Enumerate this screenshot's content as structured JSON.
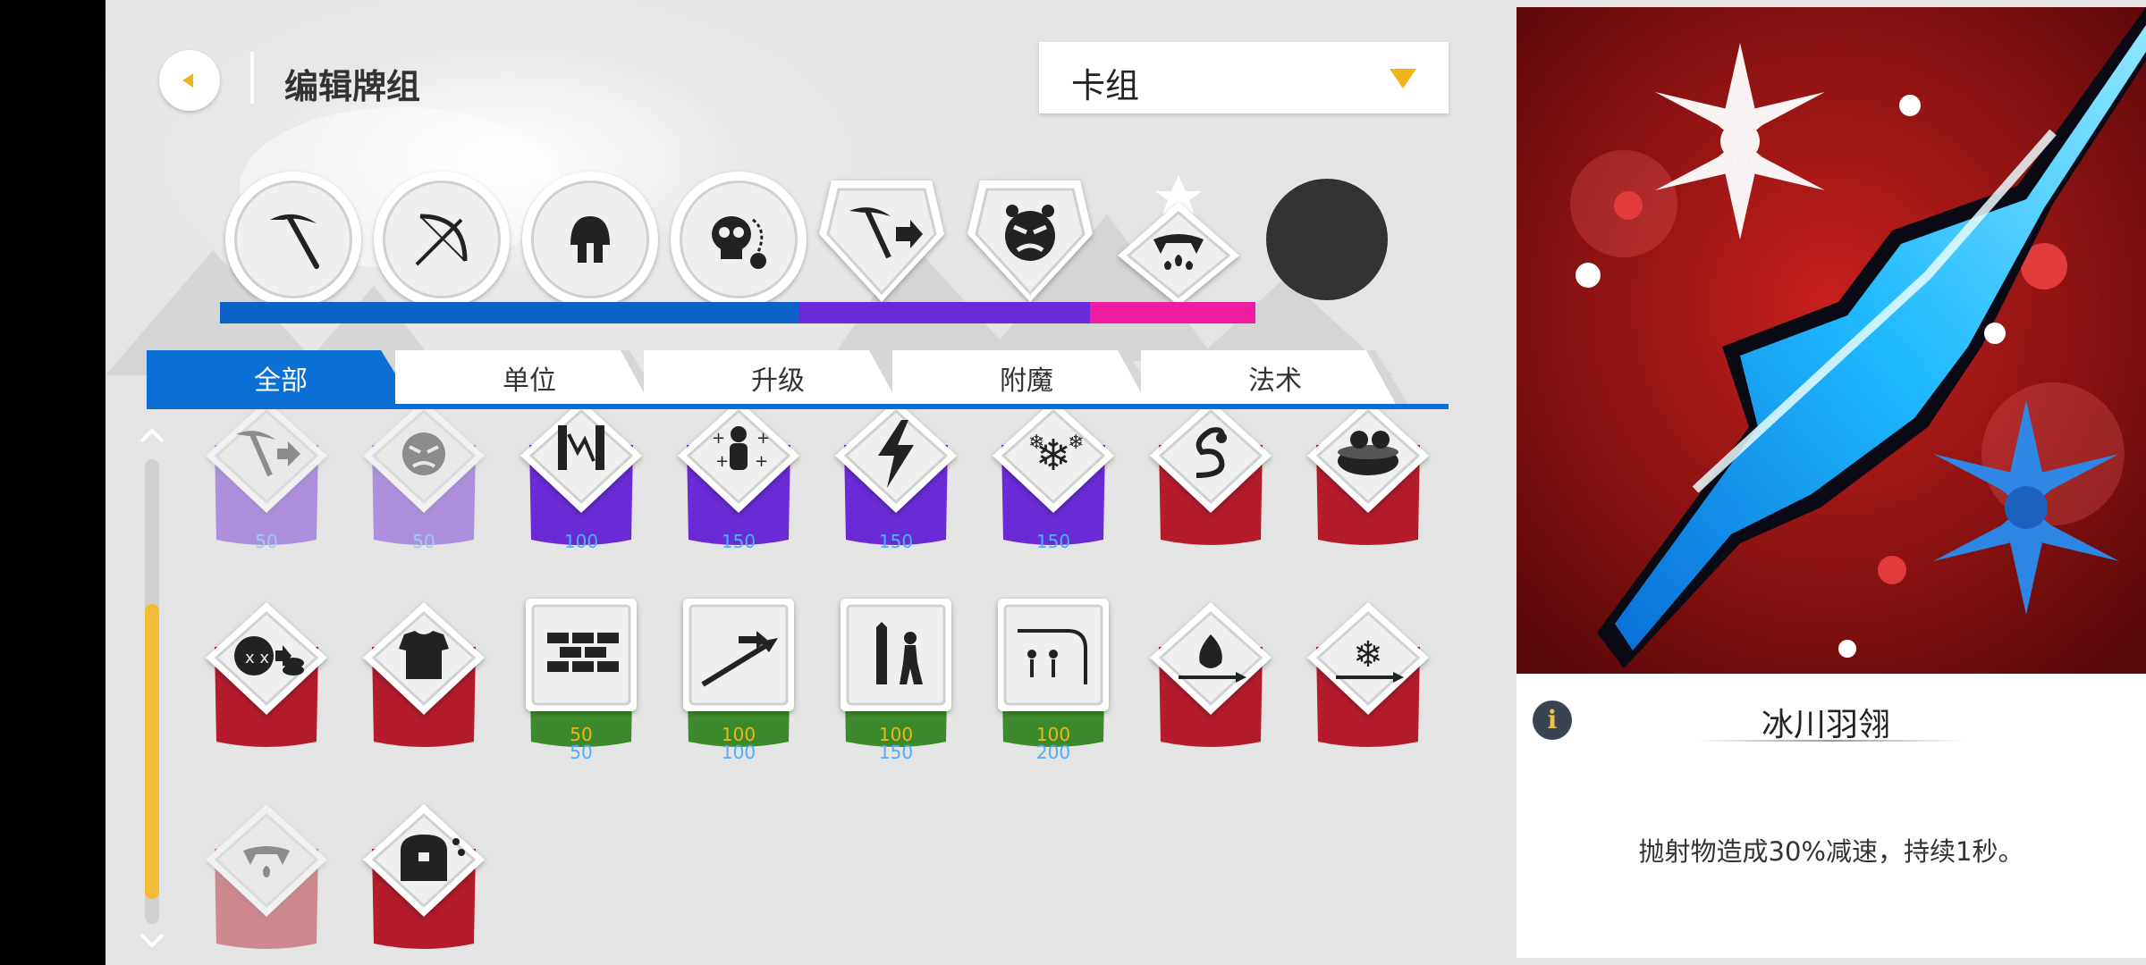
{
  "header": {
    "title": "编辑牌组",
    "deck_selector": "卡组"
  },
  "deck_slots": [
    {
      "name": "pickaxe-icon"
    },
    {
      "name": "bow-icon"
    },
    {
      "name": "helmet-icon"
    },
    {
      "name": "skull-bomb-icon"
    },
    {
      "name": "pickaxe-upgrade-icon"
    },
    {
      "name": "angry-face-icon"
    },
    {
      "name": "fangs-drops-icon"
    },
    {
      "name": "empty-slot"
    }
  ],
  "deck_bar": {
    "segments": [
      {
        "color": "#0b63c9",
        "fraction": 0.56
      },
      {
        "color": "#6a2bd6",
        "fraction": 0.28
      },
      {
        "color": "#ee1ca0",
        "fraction": 0.16
      }
    ]
  },
  "tabs": [
    {
      "label": "全部",
      "active": true
    },
    {
      "label": "单位"
    },
    {
      "label": "升级"
    },
    {
      "label": "附魔"
    },
    {
      "label": "法术"
    }
  ],
  "cards": [
    [
      {
        "icon": "pickaxe-upgrade-icon",
        "color": "#6a2bd6",
        "gold": "",
        "mana": "50",
        "faded": true
      },
      {
        "icon": "angry-face-icon",
        "color": "#6a2bd6",
        "gold": "",
        "mana": "50",
        "faded": true
      },
      {
        "icon": "lightning-wall-icon",
        "color": "#6a2bd6",
        "gold": "",
        "mana": "100"
      },
      {
        "icon": "sparkle-figure-icon",
        "color": "#6a2bd6",
        "gold": "",
        "mana": "150"
      },
      {
        "icon": "lightning-bolt-icon",
        "color": "#6a2bd6",
        "gold": "",
        "mana": "150"
      },
      {
        "icon": "snowflakes-icon",
        "color": "#6a2bd6",
        "gold": "",
        "mana": "150"
      },
      {
        "icon": "snake-icon",
        "color": "#b41c2c",
        "gold": "",
        "mana": ""
      },
      {
        "icon": "cauldron-icon",
        "color": "#b41c2c",
        "gold": "",
        "mana": ""
      }
    ],
    [
      {
        "icon": "skull-coins-icon",
        "color": "#b41c2c",
        "gold": "",
        "mana": ""
      },
      {
        "icon": "armor-icon",
        "color": "#b41c2c",
        "gold": "",
        "mana": ""
      },
      {
        "icon": "wall-icon",
        "color": "#3d8a2c",
        "gold": "50",
        "mana": "50"
      },
      {
        "icon": "spear-icon",
        "color": "#3d8a2c",
        "gold": "100",
        "mana": "100"
      },
      {
        "icon": "statue-icon",
        "color": "#3d8a2c",
        "gold": "100",
        "mana": "150"
      },
      {
        "icon": "retreat-icon",
        "color": "#3d8a2c",
        "gold": "100",
        "mana": "200"
      },
      {
        "icon": "fire-arrow-icon",
        "color": "#b41c2c",
        "gold": "",
        "mana": ""
      },
      {
        "icon": "ice-arrow-icon",
        "color": "#b41c2c",
        "gold": "",
        "mana": ""
      }
    ],
    [
      {
        "icon": "fangs-drops-icon",
        "color": "#b41c2c",
        "gold": "",
        "mana": "",
        "faded": true
      },
      {
        "icon": "treasure-chest-icon",
        "color": "#b41c2c",
        "gold": "",
        "mana": ""
      }
    ]
  ],
  "selected_card": {
    "name": "冰川羽翎",
    "description": "抛射物造成30%减速，持续1秒。",
    "info_icon": "i"
  },
  "colors": {
    "accent": "#0b6fd6",
    "gold": "#f0b41a",
    "mana": "#4ab0ff"
  }
}
